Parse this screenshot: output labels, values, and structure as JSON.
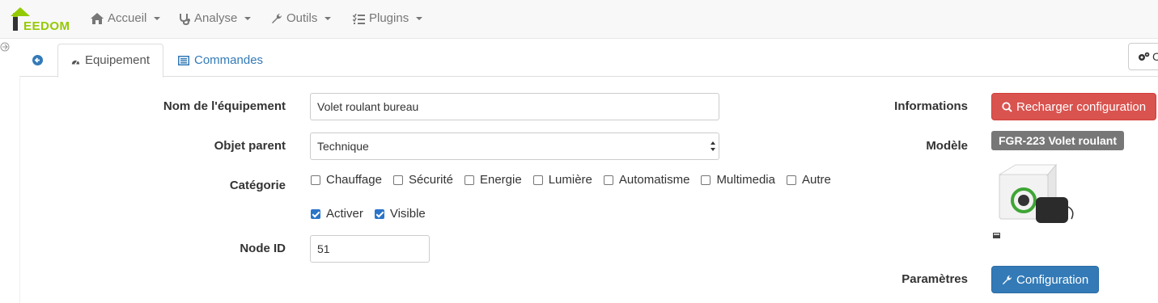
{
  "navbar": {
    "brand_first": "J",
    "brand_rest": "EEDOM",
    "items": [
      {
        "label": "Accueil",
        "icon": "home-icon"
      },
      {
        "label": "Analyse",
        "icon": "stethoscope-icon"
      },
      {
        "label": "Outils",
        "icon": "wrench-icon"
      },
      {
        "label": "Plugins",
        "icon": "tasks-icon"
      }
    ]
  },
  "tabs": [
    {
      "label": "",
      "icon": "arrow-circle-left-icon"
    },
    {
      "label": "Equipement",
      "icon": "tachometer-icon",
      "active": true
    },
    {
      "label": "Commandes",
      "icon": "list-alt-icon"
    }
  ],
  "top_right_button": {
    "label": "C",
    "icon": "cogs-icon"
  },
  "form": {
    "name_label": "Nom de l'équipement",
    "name_value": "Volet roulant bureau",
    "parent_label": "Objet parent",
    "parent_value": "Technique",
    "category_label": "Catégorie",
    "categories": [
      {
        "label": "Chauffage",
        "checked": false
      },
      {
        "label": "Sécurité",
        "checked": false
      },
      {
        "label": "Energie",
        "checked": false
      },
      {
        "label": "Lumière",
        "checked": false
      },
      {
        "label": "Automatisme",
        "checked": false
      },
      {
        "label": "Multimedia",
        "checked": false
      },
      {
        "label": "Autre",
        "checked": false
      }
    ],
    "status": [
      {
        "label": "Activer",
        "checked": true
      },
      {
        "label": "Visible",
        "checked": true
      }
    ],
    "node_label": "Node ID",
    "node_value": "51"
  },
  "info": {
    "informations_label": "Informations",
    "reload_button": "Recharger configuration",
    "model_label": "Modèle",
    "model_value": "FGR-223 Volet roulant",
    "params_label": "Paramètres",
    "config_button": "Configuration"
  },
  "colors": {
    "accent": "#337ab7",
    "danger": "#d9534f",
    "brand_green": "#94ca02"
  }
}
